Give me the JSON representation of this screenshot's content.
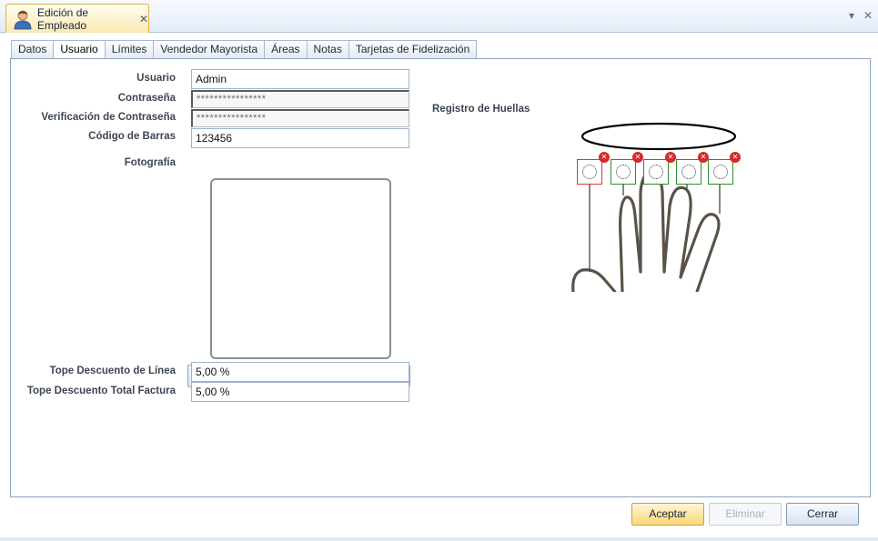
{
  "doc_tab": {
    "title": "Edición de Empleado",
    "close_glyph": "✕",
    "icon": "user-icon"
  },
  "strip_controls": {
    "dropdown_glyph": "▾",
    "close_glyph": "✕"
  },
  "tabs": [
    "Datos",
    "Usuario",
    "Límites",
    "Vendedor Mayorista",
    "Áreas",
    "Notas",
    "Tarjetas de Fidelización"
  ],
  "active_tab": "Usuario",
  "form": {
    "usuario": {
      "label": "Usuario",
      "value": "Admin"
    },
    "contrasena": {
      "label": "Contraseña",
      "value": "****************"
    },
    "verificacion": {
      "label": "Verificación de Contraseña",
      "value": "****************"
    },
    "codigo_barras": {
      "label": "Código de Barras",
      "value": "123456"
    },
    "fotografia": {
      "label": "Fotografía"
    },
    "browse_label": "...",
    "tope_linea": {
      "label": "Tope Descuento de Línea",
      "value": "5,00 %"
    },
    "tope_total": {
      "label": "Tope Descuento Total Factura",
      "value": "5,00 %"
    }
  },
  "huellas": {
    "title": "Registro de Huellas",
    "fingers": [
      {
        "name": "finger-1",
        "status_color": "#e0333a"
      },
      {
        "name": "finger-2",
        "status_color": "#2e8b2e"
      },
      {
        "name": "finger-3",
        "status_color": "#2e8b2e"
      },
      {
        "name": "finger-4",
        "status_color": "#2e8b2e"
      },
      {
        "name": "finger-5",
        "status_color": "#2e8b2e"
      }
    ]
  },
  "buttons": {
    "accept": "Aceptar",
    "delete": "Eliminar",
    "close": "Cerrar"
  },
  "colors": {
    "accent": "#fbd876",
    "panel_border": "#8ea4c2",
    "background": "#dfe8f5"
  }
}
